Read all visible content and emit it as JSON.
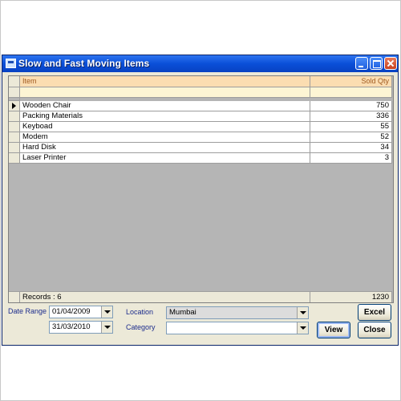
{
  "window": {
    "title": "Slow and Fast Moving Items"
  },
  "grid": {
    "columns": [
      {
        "label": "Item"
      },
      {
        "label": "Sold Qty"
      }
    ],
    "rows": [
      {
        "item": "Wooden Chair",
        "qty": "750",
        "selected": true
      },
      {
        "item": "Packing Materials",
        "qty": "336"
      },
      {
        "item": "Keyboad",
        "qty": "55"
      },
      {
        "item": "Modem",
        "qty": "52"
      },
      {
        "item": "Hard Disk",
        "qty": "34"
      },
      {
        "item": "Laser Printer",
        "qty": "3"
      }
    ],
    "footer": {
      "records_label": "Records : 6",
      "total": "1230"
    }
  },
  "filters": {
    "date_range_label": "Date Range",
    "date_from": "01/04/2009",
    "date_to": "31/03/2010",
    "location_label": "Location",
    "location_value": "Mumbai",
    "category_label": "Category",
    "category_value": ""
  },
  "buttons": {
    "excel": "Excel",
    "view": "View",
    "close": "Close"
  },
  "colors": {
    "title_bar": "#0a4fd8",
    "header_bg": "#fbddb1",
    "grid_bg": "#b5b5b5"
  }
}
